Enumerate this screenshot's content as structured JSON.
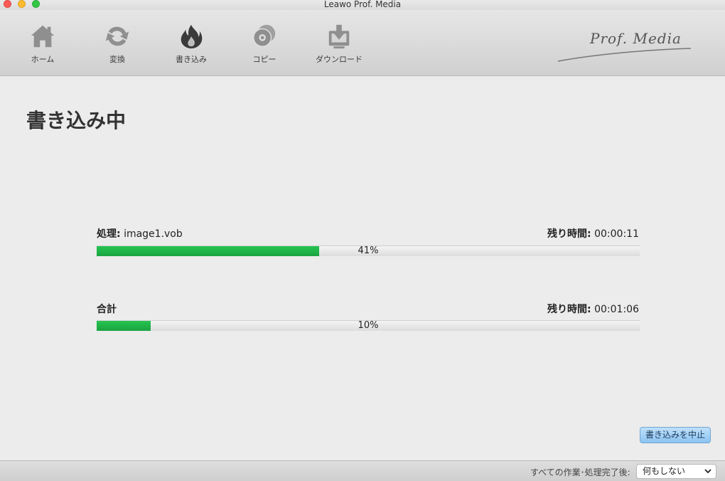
{
  "window": {
    "title": "Leawo Prof. Media"
  },
  "toolbar": {
    "items": [
      {
        "label": "ホーム",
        "icon": "home-icon"
      },
      {
        "label": "変換",
        "icon": "convert-icon"
      },
      {
        "label": "書き込み",
        "icon": "burn-icon"
      },
      {
        "label": "コピー",
        "icon": "copy-icon"
      },
      {
        "label": "ダウンロード",
        "icon": "download-icon"
      }
    ],
    "logo": "Prof. Media"
  },
  "page": {
    "title": "書き込み中"
  },
  "current": {
    "label": "処理:",
    "filename": "image1.vob",
    "remaining_label": "残り時間:",
    "remaining": "00:00:11",
    "percent_text": "41%",
    "progress": 0.41
  },
  "total": {
    "label": "合計",
    "remaining_label": "残り時間:",
    "remaining": "00:01:06",
    "percent_text": "10%",
    "progress": 0.1
  },
  "actions": {
    "stop_label": "書き込みを中止"
  },
  "footer": {
    "after_label": "すべての作業･処理完了後:",
    "after_value": "何もしない"
  },
  "colors": {
    "progress_fill": "#1fb248",
    "accent_button": "#8cc4f1"
  }
}
